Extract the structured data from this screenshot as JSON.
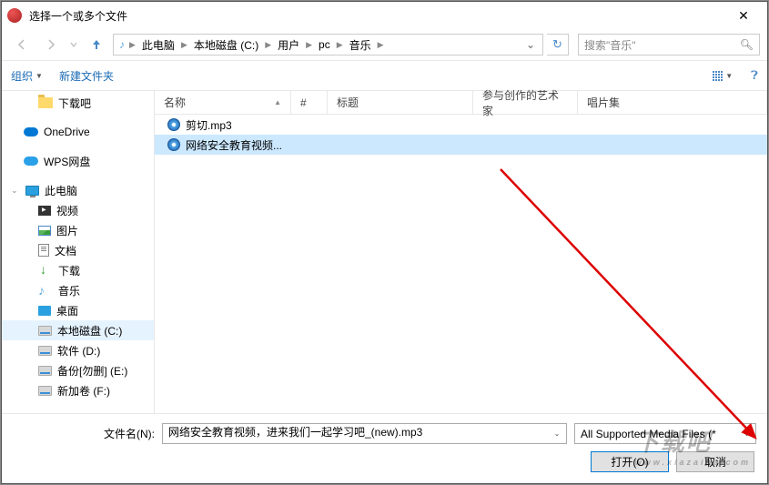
{
  "title": "选择一个或多个文件",
  "breadcrumbs": [
    "此电脑",
    "本地磁盘 (C:)",
    "用户",
    "pc",
    "音乐"
  ],
  "search_placeholder": "搜索\"音乐\"",
  "toolbar": {
    "organize": "组织",
    "new_folder": "新建文件夹"
  },
  "columns": {
    "name": "名称",
    "number": "#",
    "title": "标题",
    "artist": "参与创作的艺术家",
    "album": "唱片集"
  },
  "files": [
    {
      "name": "剪切.mp3",
      "selected": false
    },
    {
      "name": "网络安全教育视频...",
      "selected": true
    }
  ],
  "sidebar": {
    "items": [
      {
        "label": "下载吧",
        "icon": "folder",
        "sub": true
      },
      {
        "label": "OneDrive",
        "icon": "onedrive",
        "sub": false,
        "gapBefore": true
      },
      {
        "label": "WPS网盘",
        "icon": "wps",
        "sub": false,
        "gapBefore": true
      },
      {
        "label": "此电脑",
        "icon": "monitor",
        "sub": false,
        "gapBefore": true,
        "expand": true
      },
      {
        "label": "视频",
        "icon": "video",
        "sub": true
      },
      {
        "label": "图片",
        "icon": "pic",
        "sub": true
      },
      {
        "label": "文档",
        "icon": "doc",
        "sub": true
      },
      {
        "label": "下载",
        "icon": "dl",
        "sub": true
      },
      {
        "label": "音乐",
        "icon": "music",
        "sub": true
      },
      {
        "label": "桌面",
        "icon": "desk",
        "sub": true
      },
      {
        "label": "本地磁盘 (C:)",
        "icon": "disk",
        "sub": true,
        "selected": true
      },
      {
        "label": "软件 (D:)",
        "icon": "disk",
        "sub": true
      },
      {
        "label": "备份[勿删] (E:)",
        "icon": "disk",
        "sub": true
      },
      {
        "label": "新加卷 (F:)",
        "icon": "disk",
        "sub": true
      }
    ]
  },
  "filename_label": "文件名(N):",
  "filename_value": "网络安全教育视频，进来我们一起学习吧_(new).mp3",
  "filter": "All Supported Media Files (*",
  "open_btn": "打开(O)",
  "cancel_btn": "取消",
  "watermark": "下载吧",
  "watermark_sub": "www.xiazaiba.com"
}
